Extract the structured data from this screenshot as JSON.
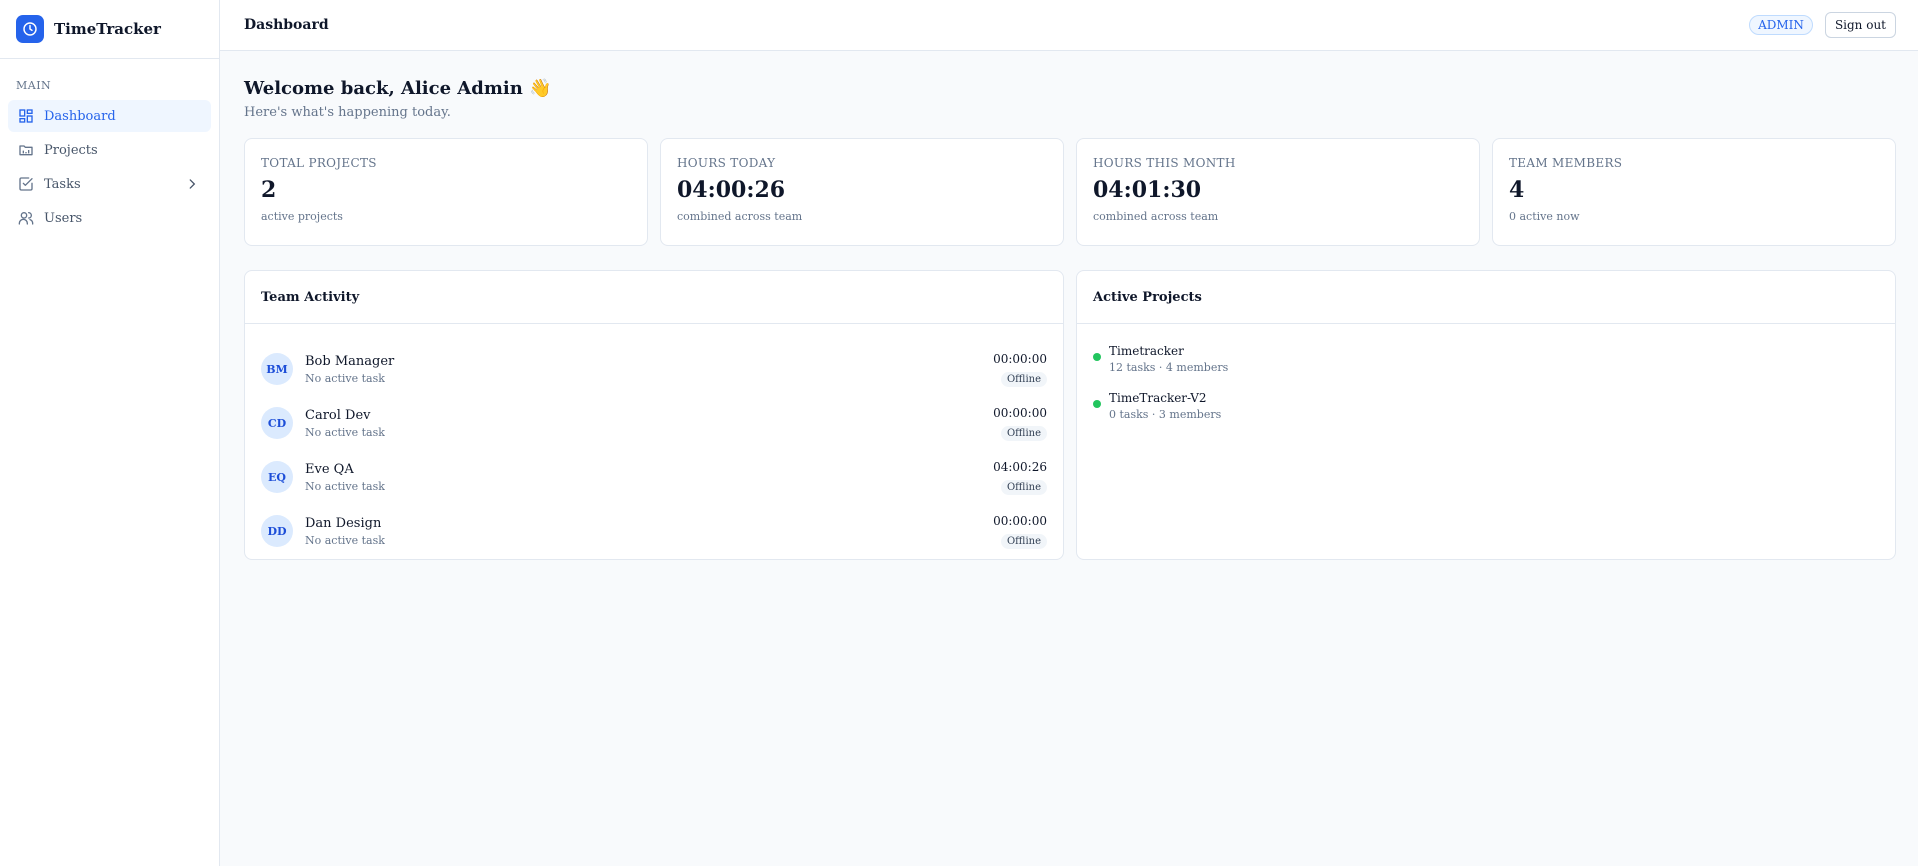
{
  "app": {
    "name": "TimeTracker",
    "logo_icon": "clock-icon",
    "accent": "#2563eb"
  },
  "sidebar": {
    "section": "MAIN",
    "items": [
      {
        "label": "Dashboard",
        "icon": "grid-icon",
        "active": true
      },
      {
        "label": "Projects",
        "icon": "folder-icon"
      },
      {
        "label": "Tasks",
        "icon": "checkbox-icon",
        "has_children": true
      },
      {
        "label": "Users",
        "icon": "users-icon"
      }
    ]
  },
  "header": {
    "title": "Dashboard",
    "role": "ADMIN",
    "signout_label": "Sign out"
  },
  "welcome": {
    "title": "Welcome back, Alice Admin 👋",
    "subtitle": "Here's what's happening today."
  },
  "stats": [
    {
      "label": "TOTAL PROJECTS",
      "value": "2",
      "sub": "active projects"
    },
    {
      "label": "HOURS TODAY",
      "value": "04:00:26",
      "sub": "combined across team"
    },
    {
      "label": "HOURS THIS MONTH",
      "value": "04:01:30",
      "sub": "combined across team"
    },
    {
      "label": "TEAM MEMBERS",
      "value": "4",
      "sub": "0 active now"
    }
  ],
  "team_activity": {
    "title": "Team Activity",
    "members": [
      {
        "initials": "BM",
        "name": "Bob Manager",
        "task": "No active task",
        "time": "00:00:00",
        "status": "Offline"
      },
      {
        "initials": "CD",
        "name": "Carol Dev",
        "task": "No active task",
        "time": "00:00:00",
        "status": "Offline"
      },
      {
        "initials": "EQ",
        "name": "Eve QA",
        "task": "No active task",
        "time": "04:00:26",
        "status": "Offline"
      },
      {
        "initials": "DD",
        "name": "Dan Design",
        "task": "No active task",
        "time": "00:00:00",
        "status": "Offline"
      }
    ]
  },
  "active_projects": {
    "title": "Active Projects",
    "projects": [
      {
        "name": "Timetracker",
        "meta": "12 tasks · 4 members",
        "status_color": "#22c55e"
      },
      {
        "name": "TimeTracker-V2",
        "meta": "0 tasks · 3 members",
        "status_color": "#22c55e"
      }
    ]
  }
}
